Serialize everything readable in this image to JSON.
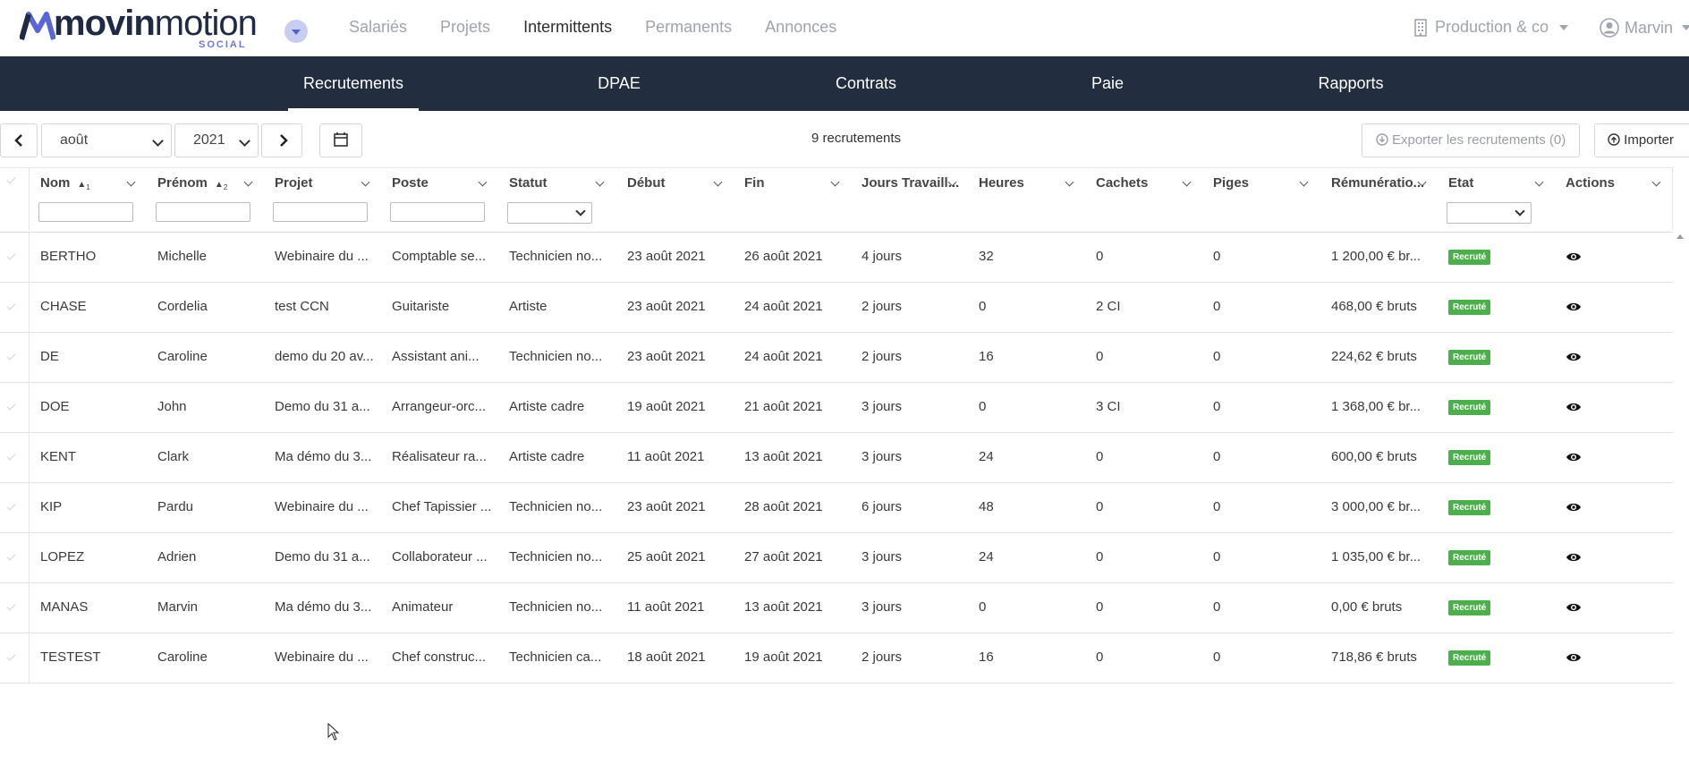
{
  "brand": {
    "name_a": "movin",
    "name_b": "motion",
    "sub": "SOCIAL"
  },
  "topnav": [
    "Salariés",
    "Projets",
    "Intermittents",
    "Permanents",
    "Annonces"
  ],
  "topnav_active": 2,
  "company": "Production & co",
  "user": "Marvin",
  "subnav": [
    "Recrutements",
    "DPAE",
    "Contrats",
    "Paie",
    "Rapports"
  ],
  "subnav_active": 0,
  "toolbar": {
    "month": "août",
    "year": "2021",
    "count": "9 recrutements",
    "export": "Exporter les recrutements (0)",
    "import": "Importer"
  },
  "columns": [
    {
      "label": "Nom",
      "sort": "1",
      "filter": "text"
    },
    {
      "label": "Prénom",
      "sort": "2",
      "filter": "text"
    },
    {
      "label": "Projet",
      "filter": "text"
    },
    {
      "label": "Poste",
      "filter": "text"
    },
    {
      "label": "Statut",
      "filter": "select"
    },
    {
      "label": "Début"
    },
    {
      "label": "Fin"
    },
    {
      "label": "Jours Travaill..."
    },
    {
      "label": "Heures"
    },
    {
      "label": "Cachets"
    },
    {
      "label": "Piges"
    },
    {
      "label": "Rémunératio..."
    },
    {
      "label": "Etat",
      "filter": "select"
    },
    {
      "label": "Actions"
    }
  ],
  "rows": [
    [
      "BERTHO",
      "Michelle",
      "Webinaire du ...",
      "Comptable se...",
      "Technicien no...",
      "23 août 2021",
      "26 août 2021",
      "4 jours",
      "32",
      "0",
      "0",
      "1 200,00 € br...",
      "Recruté"
    ],
    [
      "CHASE",
      "Cordelia",
      "test CCN",
      "Guitariste",
      "Artiste",
      "23 août 2021",
      "24 août 2021",
      "2 jours",
      "0",
      "2 CI",
      "0",
      "468,00 € bruts",
      "Recruté"
    ],
    [
      "DE",
      "Caroline",
      "demo du 20 av...",
      "Assistant ani...",
      "Technicien no...",
      "23 août 2021",
      "24 août 2021",
      "2 jours",
      "16",
      "0",
      "0",
      "224,62 € bruts",
      "Recruté"
    ],
    [
      "DOE",
      "John",
      "Demo du 31 a...",
      "Arrangeur-orc...",
      "Artiste cadre",
      "19 août 2021",
      "21 août 2021",
      "3 jours",
      "0",
      "3 CI",
      "0",
      "1 368,00 € br...",
      "Recruté"
    ],
    [
      "KENT",
      "Clark",
      "Ma démo du 3...",
      "Réalisateur ra...",
      "Artiste cadre",
      "11 août 2021",
      "13 août 2021",
      "3 jours",
      "24",
      "0",
      "0",
      "600,00 € bruts",
      "Recruté"
    ],
    [
      "KIP",
      "Pardu",
      "Webinaire du ...",
      "Chef Tapissier ...",
      "Technicien no...",
      "23 août 2021",
      "28 août 2021",
      "6 jours",
      "48",
      "0",
      "0",
      "3 000,00 € br...",
      "Recruté"
    ],
    [
      "LOPEZ",
      "Adrien",
      "Demo du 31 a...",
      "Collaborateur ...",
      "Technicien no...",
      "25 août 2021",
      "27 août 2021",
      "3 jours",
      "24",
      "0",
      "0",
      "1 035,00 € br...",
      "Recruté"
    ],
    [
      "MANAS",
      "Marvin",
      "Ma démo du 3...",
      "Animateur",
      "Technicien no...",
      "11 août 2021",
      "13 août 2021",
      "3 jours",
      "0",
      "0",
      "0",
      "0,00 € bruts",
      "Recruté"
    ],
    [
      "TESTEST",
      "Caroline",
      "Webinaire du ...",
      "Chef construc...",
      "Technicien ca...",
      "18 août 2021",
      "19 août 2021",
      "2 jours",
      "16",
      "0",
      "0",
      "718,86 € bruts",
      "Recruté"
    ]
  ]
}
